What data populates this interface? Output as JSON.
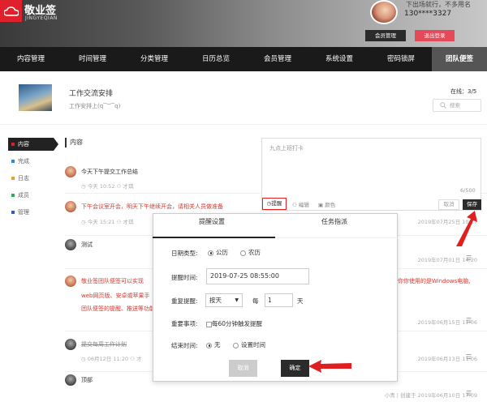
{
  "header": {
    "logo_name": "敬业签",
    "logo_sub": "JINGYEQIAN",
    "user_top": "下出场就行，不多用名",
    "user_phone": "130****3327",
    "member_button": "会员管理",
    "logout_button": "退出登录"
  },
  "nav": {
    "items": [
      "内容管理",
      "时间管理",
      "分类管理",
      "日历总览",
      "会员管理",
      "系统设置",
      "密码锁屏",
      "团队便签"
    ],
    "active_index": 7
  },
  "group": {
    "title": "工作交流安排",
    "subtitle": "工作安排上(q‾︶‾q)",
    "online": "在线：3/5",
    "search_placeholder": "搜索"
  },
  "sidebar": {
    "items": [
      {
        "label": "内容",
        "color": "#e02020"
      },
      {
        "label": "完成",
        "color": "#2e8bd9"
      },
      {
        "label": "日志",
        "color": "#f0a020"
      },
      {
        "label": "成员",
        "color": "#2cb04a"
      },
      {
        "label": "管理",
        "color": "#2e5bd9"
      }
    ]
  },
  "content": {
    "title": "内容",
    "posts": [
      {
        "text": "今天下午提交工作总结",
        "time": "今天 10:52",
        "author": "才琪",
        "right": ""
      },
      {
        "text": "下午会议室开会，明天下午继续开会，请相关人员做准备",
        "time": "今天 15:21",
        "author": "才琪",
        "right": "2019年07月25日 10:17"
      },
      {
        "text": "测试",
        "time": "",
        "author": "",
        "right": "2019年07月01日 14:20"
      },
      {
        "text": "敬业签团队便签可以实现",
        "text2": "你你使用的是Windows电脑,",
        "text3": "web网页版、安卓或苹果手",
        "text4": "团队便签的提醒、推送等功能",
        "time": "",
        "author": "",
        "right": "2019年06月15日 11:06"
      },
      {
        "text": "提交每周工作计划",
        "time": "06月12日 11:20",
        "author": "才",
        "right": "2019年06月13日 11:06"
      },
      {
        "text": "顶部",
        "time": "",
        "author": "",
        "right": "小青 | 创建于 2019年06月10日 17:09"
      }
    ]
  },
  "editor": {
    "placeholder": "九点上班打卡",
    "count": "6/500",
    "remind_label": "提醒",
    "attach_label": "编辑",
    "color_label": "颜色",
    "cancel_label": "取消",
    "save_label": "保存"
  },
  "modal": {
    "tab_remind": "提醒设置",
    "tab_task": "任务指派",
    "date_type_label": "日期类型:",
    "opt_solar": "公历",
    "opt_lunar": "农历",
    "remind_time_label": "提醒时间:",
    "remind_time_value": "2019-07-25 08:55:00",
    "repeat_label": "重复提醒:",
    "repeat_value": "按天",
    "every_label": "每",
    "every_value": "1",
    "day_label": "天",
    "important_label": "重要事项:",
    "important_opt": "每60分钟触发提醒",
    "end_time_label": "结束时间:",
    "end_opt_none": "无",
    "end_opt_set": "设置时间",
    "cancel_button": "取消",
    "ok_button": "确定"
  }
}
